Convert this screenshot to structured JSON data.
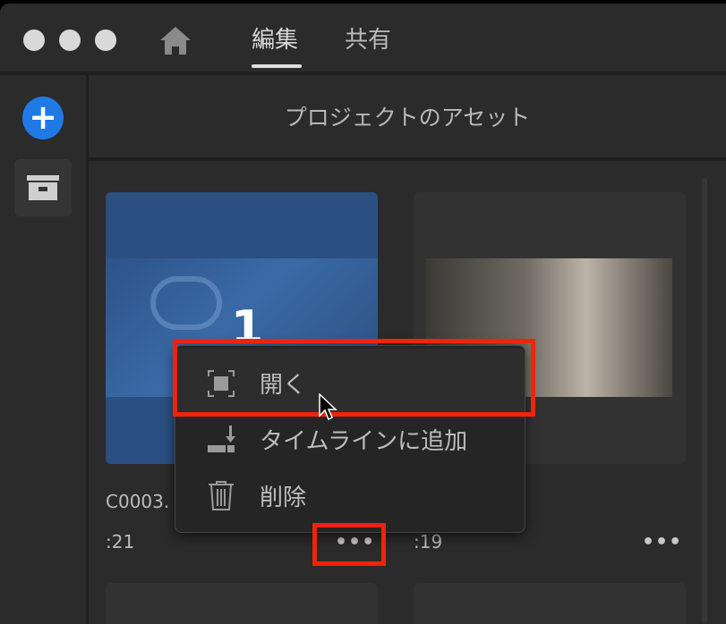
{
  "topbar": {
    "tabs": [
      {
        "label": "編集",
        "active": true
      },
      {
        "label": "共有",
        "active": false
      }
    ]
  },
  "header": {
    "title": "プロジェクトのアセット"
  },
  "assets": [
    {
      "name": "C0003.",
      "duration": ":21",
      "thumb_text": "1"
    },
    {
      "name": "",
      "duration": ":19"
    }
  ],
  "context_menu": {
    "items": [
      {
        "label": "開く",
        "icon": "open-frame-icon"
      },
      {
        "label": "タイムラインに追加",
        "icon": "add-to-timeline-icon"
      },
      {
        "label": "削除",
        "icon": "trash-icon"
      }
    ]
  },
  "colors": {
    "accent": "#1f7ae6",
    "highlight": "#f0230e",
    "background": "#2b2b2b"
  }
}
